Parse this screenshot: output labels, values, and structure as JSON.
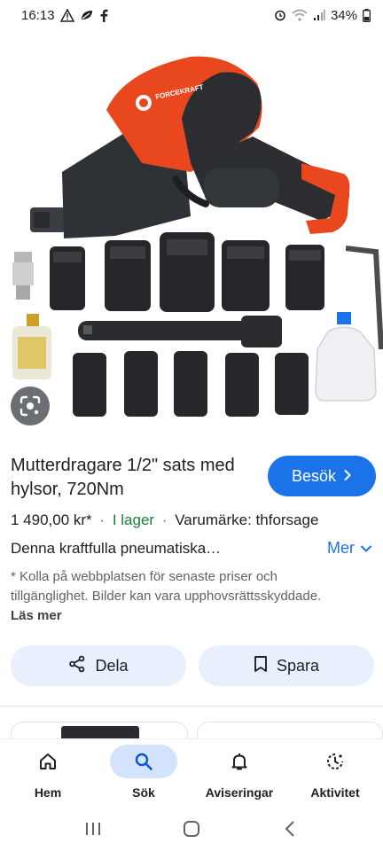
{
  "status_bar": {
    "time": "16:13",
    "battery": "34%",
    "left_icons": [
      "warning-icon",
      "leaf-icon",
      "facebook-icon"
    ],
    "right_icons": [
      "alarm-icon",
      "wifi-icon",
      "signal-icon",
      "battery-icon"
    ]
  },
  "product_image": {
    "brand_on_tool": "FORCEKRAFT",
    "lens_icon": "google-lens-icon"
  },
  "product": {
    "title": "Mutterdragare 1/2\" sats med hylsor, 720Nm",
    "visit_label": "Besök",
    "price": "1 490,00 kr*",
    "availability": "I lager",
    "brand_text": "Varumärke: thforsage",
    "description": "Denna kraftfulla pneumatiska…",
    "more_label": "Mer",
    "disclaimer": "* Kolla på webbplatsen för senaste priser och tillgänglighet. Bilder kan vara upphovsrättsskyddade.",
    "read_more_label": "Läs mer",
    "separator": "·"
  },
  "actions": {
    "share_label": "Dela",
    "save_label": "Spara"
  },
  "bottom_nav": {
    "items": [
      {
        "label": "Hem",
        "icon": "home-icon",
        "active": false
      },
      {
        "label": "Sök",
        "icon": "search-icon",
        "active": true
      },
      {
        "label": "Aviseringar",
        "icon": "bell-icon",
        "active": false
      },
      {
        "label": "Aktivitet",
        "icon": "activity-icon",
        "active": false
      }
    ]
  },
  "colors": {
    "accent": "#1a73e8",
    "in_stock": "#188038",
    "chip_bg": "#e8f0fe",
    "nav_active_bg": "#d3e3fd",
    "tool_orange": "#f04a1c"
  }
}
